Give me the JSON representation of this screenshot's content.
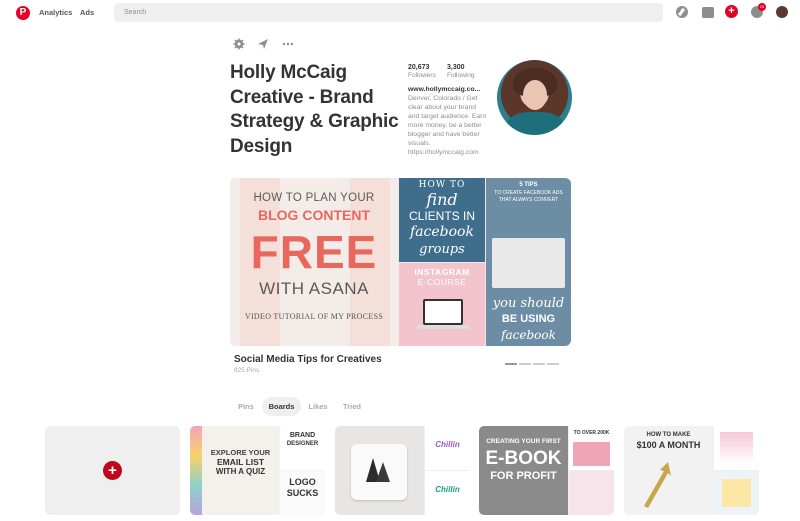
{
  "nav": {
    "logo": "P",
    "analytics": "Analytics",
    "ads": "Ads",
    "search_placeholder": "Search",
    "add_icon": "+",
    "notification_count": "15"
  },
  "profile": {
    "name": "Holly McCaig Creative - Brand Strategy & Graphic Design",
    "followers_count": "20,673",
    "followers_label": "Followers",
    "following_count": "3,300",
    "following_label": "Following",
    "website": "www.hollymccaig.co...",
    "bio": "Denver, Colorado / Get clear about your brand and target audience. Earn more money, be a better blogger and have better visuals. https://hollymccaig.com"
  },
  "featured_board": {
    "title": "Social Media Tips for Creatives",
    "pins": "825 Pins",
    "cover_lines": [
      "HOW TO PLAN YOUR",
      "BLOG CONTENT",
      "FREE",
      "WITH ASANA",
      "VIDEO TUTORIAL OF MY PROCESS"
    ],
    "tile1_lines": [
      "HOW TO",
      "find",
      "CLIENTS IN",
      "facebook",
      "groups"
    ],
    "tile2_lines": [
      "INSTAGRAM",
      "E-COURSE"
    ],
    "tile3_lines": [
      "5 TIPS",
      "TO CREATE FACEBOOK ADS",
      "THAT ALWAYS CONVERT",
      "you should",
      "BE USING",
      "facebook"
    ]
  },
  "tabs": [
    {
      "label": "Pins",
      "active": false
    },
    {
      "label": "Boards",
      "active": true
    },
    {
      "label": "Likes",
      "active": false
    },
    {
      "label": "Tried",
      "active": false
    }
  ],
  "boards": {
    "create_icon": "+",
    "card1_lines": [
      "EXPLORE YOUR",
      "EMAIL LIST",
      "WITH A QUIZ",
      "BRAND",
      "DESIGNER",
      "LOGO",
      "SUCKS"
    ],
    "card3_lines": [
      "Chillin",
      "Chillin"
    ],
    "card4_lines": [
      "CREATING YOUR FIRST",
      "E-BOOK",
      "FOR PROFIT",
      "TO OVER 200K"
    ],
    "card5_lines": [
      "HOW TO MAKE",
      "$100 A MONTH"
    ]
  },
  "colors": {
    "brand_red": "#e60023",
    "cover_coral": "#e8685e"
  }
}
